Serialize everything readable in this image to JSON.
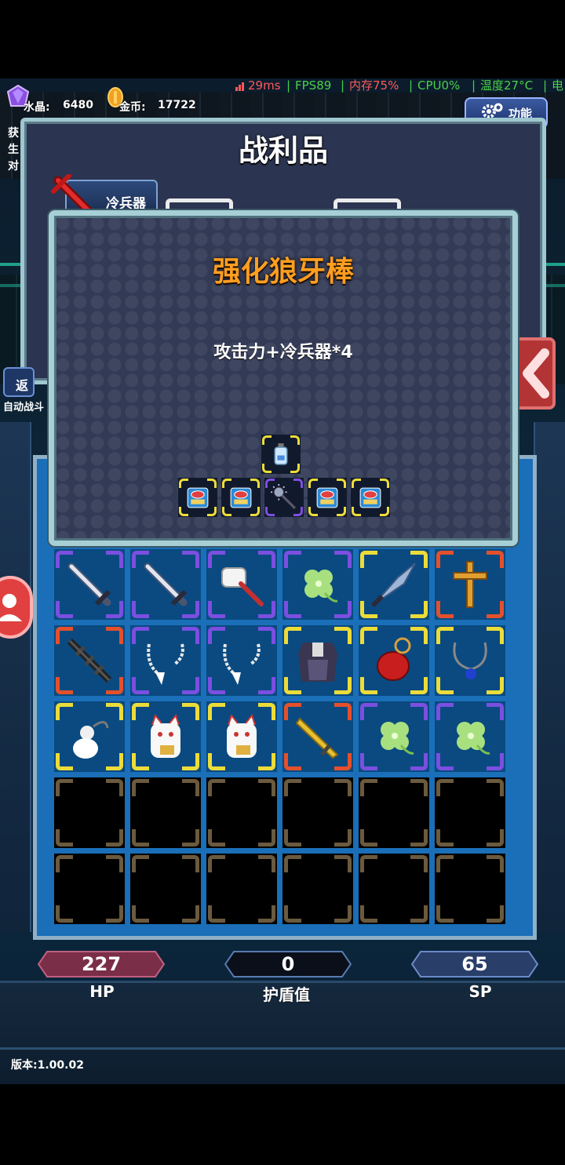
{
  "status_bar": {
    "ping": "29ms",
    "fps": "FPS89",
    "memory": "内存75%",
    "cpu": "CPU0%",
    "temperature": "温度27°C",
    "battery": "电"
  },
  "currency": {
    "crystal_label": "水晶:",
    "crystal_value": "6480",
    "gold_label": "金币:",
    "gold_value": "17722"
  },
  "function_button": "功能",
  "loot_panel": {
    "title": "战利品",
    "category_tab": "冷兵器"
  },
  "side_text": {
    "left_chars": [
      "获",
      "生",
      "对"
    ],
    "auto_battle": "自动战斗"
  },
  "detail_popup": {
    "title": "强化狼牙棒",
    "description": "攻击力+冷兵器*4",
    "recipe_top": {
      "icon": "potion-bottle-icon",
      "rarity": "yellow"
    },
    "recipe_row": [
      {
        "icon": "scroll-pouch-icon",
        "rarity": "yellow"
      },
      {
        "icon": "scroll-pouch-icon",
        "rarity": "yellow"
      },
      {
        "icon": "mace-icon",
        "rarity": "purple"
      },
      {
        "icon": "scroll-pouch-icon",
        "rarity": "yellow"
      },
      {
        "icon": "scroll-pouch-icon",
        "rarity": "yellow"
      }
    ]
  },
  "inventory": {
    "rows": [
      [
        {
          "icon": "sword-icon",
          "rarity": "purple"
        },
        {
          "icon": "sword-icon",
          "rarity": "purple"
        },
        {
          "icon": "hammer-icon",
          "rarity": "purple"
        },
        {
          "icon": "clover-icon",
          "rarity": "purple"
        },
        {
          "icon": "blade-icon",
          "rarity": "yellow"
        },
        {
          "icon": "cross-icon",
          "rarity": "red"
        }
      ],
      [
        {
          "icon": "dark-spiked-blade-icon",
          "rarity": "red"
        },
        {
          "icon": "tooth-necklace-icon",
          "rarity": "purple"
        },
        {
          "icon": "tooth-necklace-icon",
          "rarity": "purple"
        },
        {
          "icon": "armor-icon",
          "rarity": "yellow"
        },
        {
          "icon": "red-pouch-icon",
          "rarity": "yellow"
        },
        {
          "icon": "pendant-icon",
          "rarity": "yellow"
        }
      ],
      [
        {
          "icon": "gourd-icon",
          "rarity": "yellow"
        },
        {
          "icon": "lucky-cat-icon",
          "rarity": "yellow"
        },
        {
          "icon": "lucky-cat-icon",
          "rarity": "yellow"
        },
        {
          "icon": "golden-blade-icon",
          "rarity": "red"
        },
        {
          "icon": "clover-icon",
          "rarity": "purple"
        },
        {
          "icon": "clover-icon",
          "rarity": "purple"
        }
      ],
      [
        {
          "icon": "",
          "rarity": "empty"
        },
        {
          "icon": "",
          "rarity": "empty"
        },
        {
          "icon": "",
          "rarity": "empty"
        },
        {
          "icon": "",
          "rarity": "empty"
        },
        {
          "icon": "",
          "rarity": "empty"
        },
        {
          "icon": "",
          "rarity": "empty"
        }
      ],
      [
        {
          "icon": "",
          "rarity": "empty"
        },
        {
          "icon": "",
          "rarity": "empty"
        },
        {
          "icon": "",
          "rarity": "empty"
        },
        {
          "icon": "",
          "rarity": "empty"
        },
        {
          "icon": "",
          "rarity": "empty"
        },
        {
          "icon": "",
          "rarity": "empty"
        }
      ]
    ]
  },
  "stats": {
    "hp_value": "227",
    "hp_label": "HP",
    "shield_value": "0",
    "shield_label": "护盾值",
    "sp_value": "65",
    "sp_label": "SP"
  },
  "version": "版本:1.00.02",
  "colors": {
    "rarity_purple": "#7b4fe0",
    "rarity_yellow": "#ecdc3a",
    "rarity_red": "#e4502c",
    "rarity_empty": "#6b5a3e",
    "detail_title": "#ff9e1f",
    "status_green": "#4bd04b",
    "status_red": "#ff5a5a"
  }
}
